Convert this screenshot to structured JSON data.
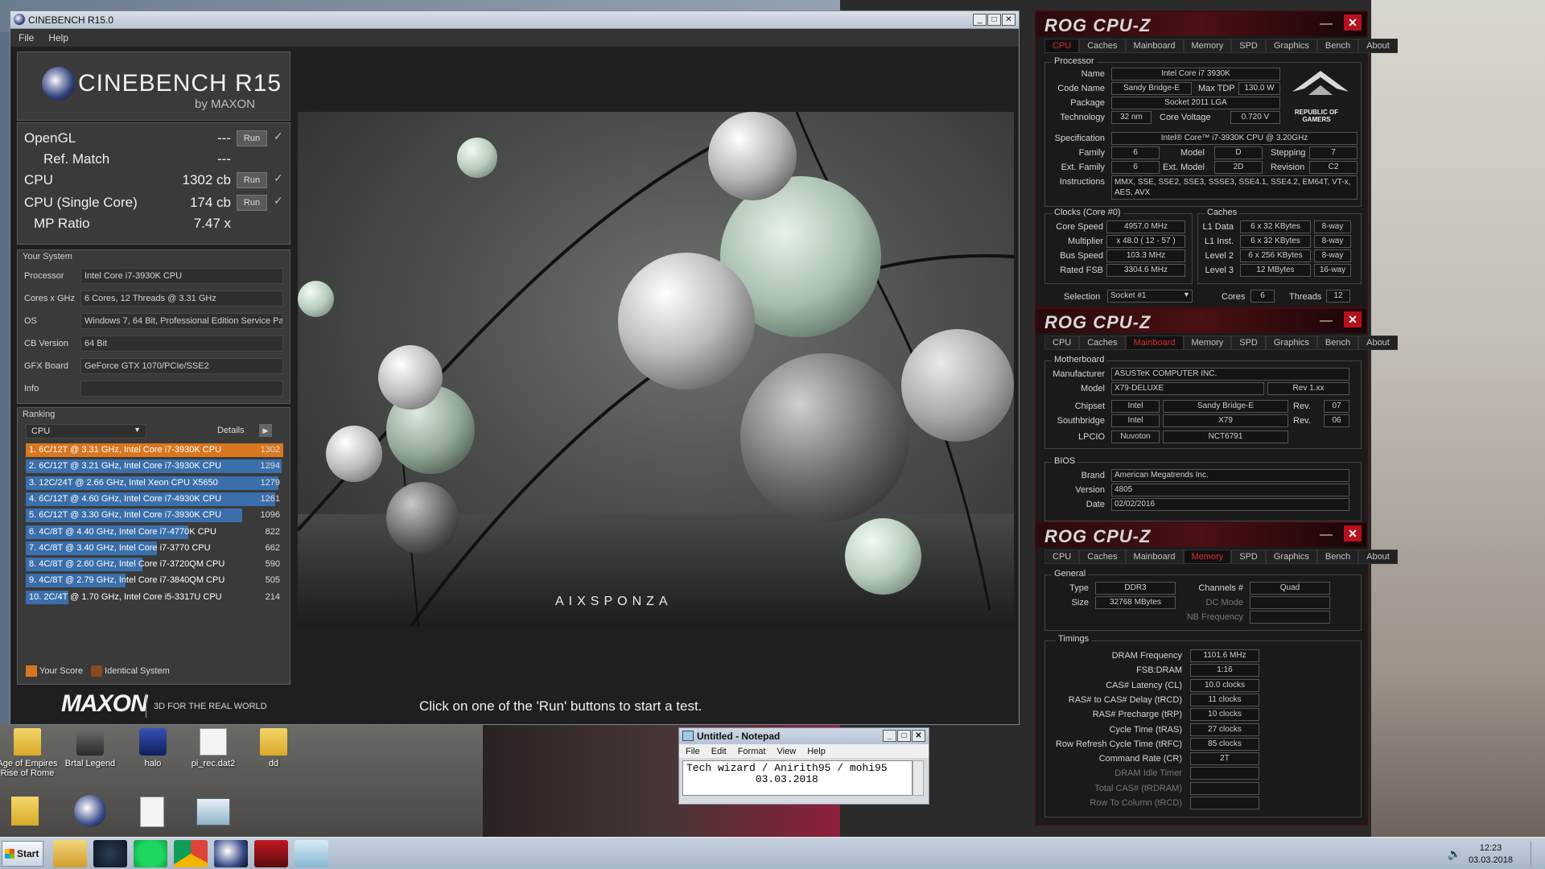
{
  "cinebench": {
    "window_title": "CINEBENCH R15.0",
    "menu": [
      "File",
      "Help"
    ],
    "logo_name": "CINEBENCH R15",
    "logo_by": "by MAXON",
    "scores": {
      "opengl_label": "OpenGL",
      "opengl_value": "---",
      "refmatch_label": "Ref. Match",
      "refmatch_value": "---",
      "cpu_label": "CPU",
      "cpu_value": "1302 cb",
      "single_label": "CPU (Single Core)",
      "single_value": "174 cb",
      "mp_label": "MP Ratio",
      "mp_value": "7.47 x",
      "run_label": "Run"
    },
    "system": {
      "title": "Your System",
      "rows": [
        {
          "k": "Processor",
          "v": "Intel Core i7-3930K CPU"
        },
        {
          "k": "Cores x GHz",
          "v": "6 Cores, 12 Threads @ 3.31 GHz"
        },
        {
          "k": "OS",
          "v": "Windows 7, 64 Bit, Professional Edition Service Pa"
        },
        {
          "k": "CB Version",
          "v": "64 Bit"
        },
        {
          "k": "GFX Board",
          "v": "GeForce GTX 1070/PCIe/SSE2"
        },
        {
          "k": "Info",
          "v": ""
        }
      ]
    },
    "ranking": {
      "title": "Ranking",
      "dropdown": "CPU",
      "details": "Details",
      "max": 1302,
      "rows": [
        {
          "label": "1. 6C/12T @ 3.31 GHz,  Intel Core i7-3930K CPU",
          "score": 1302,
          "color": "#d8771f"
        },
        {
          "label": "2. 6C/12T @ 3.21 GHz,  Intel Core i7-3930K CPU",
          "score": 1294,
          "color": "#3a6fab"
        },
        {
          "label": "3. 12C/24T @ 2.66 GHz, Intel Xeon CPU X5650",
          "score": 1279,
          "color": "#3a6fab"
        },
        {
          "label": "4. 6C/12T @ 4.60 GHz,  Intel Core i7-4930K CPU",
          "score": 1261,
          "color": "#3a6fab"
        },
        {
          "label": "5. 6C/12T @ 3.30 GHz,  Intel Core i7-3930K CPU",
          "score": 1096,
          "color": "#3a6fab"
        },
        {
          "label": "6. 4C/8T @ 4.40 GHz, Intel Core i7-4770K CPU",
          "score": 822,
          "color": "#3a6fab"
        },
        {
          "label": "7. 4C/8T @ 3.40 GHz,  Intel Core i7-3770 CPU",
          "score": 662,
          "color": "#3a6fab"
        },
        {
          "label": "8. 4C/8T @ 2.60 GHz, Intel Core i7-3720QM CPU",
          "score": 590,
          "color": "#3a6fab"
        },
        {
          "label": "9. 4C/8T @ 2.79 GHz,  Intel Core i7-3840QM CPU",
          "score": 505,
          "color": "#3a6fab"
        },
        {
          "label": "10. 2C/4T @ 1.70 GHz,  Intel Core i5-3317U CPU",
          "score": 214,
          "color": "#3a6fab"
        }
      ]
    },
    "legend": {
      "your_score": "Your Score",
      "identical": "Identical System",
      "your_color": "#d8771f",
      "identical_color": "#8a4a1c"
    },
    "footer": {
      "brand": "MAXON",
      "tagline": "3D FOR THE REAL WORLD",
      "status": "Click on one of the 'Run' buttons to start a test."
    },
    "render_credit": "AIXSPONZA"
  },
  "cpuz_cpu": {
    "logo": "ROG CPU-Z",
    "tabs": [
      "CPU",
      "Caches",
      "Mainboard",
      "Memory",
      "SPD",
      "Graphics",
      "Bench",
      "About"
    ],
    "processor_title": "Processor",
    "name_label": "Name",
    "name": "Intel Core i7 3930K",
    "codename_label": "Code Name",
    "codename": "Sandy Bridge-E",
    "maxtdp_label": "Max TDP",
    "maxtdp": "130.0 W",
    "package_label": "Package",
    "package": "Socket 2011 LGA",
    "technology_label": "Technology",
    "technology": "32 nm",
    "corevoltage_label": "Core Voltage",
    "corevoltage": "0.720 V",
    "spec_label": "Specification",
    "spec": "Intel® Core™ i7-3930K CPU @ 3.20GHz",
    "family_label": "Family",
    "family": "6",
    "model_label": "Model",
    "model": "D",
    "stepping_label": "Stepping",
    "stepping": "7",
    "extfamily_label": "Ext. Family",
    "extfamily": "6",
    "extmodel_label": "Ext. Model",
    "extmodel": "2D",
    "revision_label": "Revision",
    "revision": "C2",
    "instructions_label": "Instructions",
    "instructions": "MMX, SSE, SSE2, SSE3, SSSE3, SSE4.1, SSE4.2, EM64T, VT-x, AES, AVX",
    "clocks_title": "Clocks (Core #0)",
    "corespeed_label": "Core Speed",
    "corespeed": "4957.0 MHz",
    "multiplier_label": "Multiplier",
    "multiplier": "x 48.0 ( 12 - 57 )",
    "busspeed_label": "Bus Speed",
    "busspeed": "103.3 MHz",
    "ratedfsb_label": "Rated FSB",
    "ratedfsb": "3304.6 MHz",
    "caches_title": "Caches",
    "l1d_label": "L1 Data",
    "l1d": "6 x 32 KBytes",
    "l1d_way": "8-way",
    "l1i_label": "L1 Inst.",
    "l1i": "6 x 32 KBytes",
    "l1i_way": "8-way",
    "l2_label": "Level 2",
    "l2": "6 x 256 KBytes",
    "l2_way": "8-way",
    "l3_label": "Level 3",
    "l3": "12 MBytes",
    "l3_way": "16-way",
    "selection_label": "Selection",
    "selection": "Socket #1",
    "cores_label": "Cores",
    "cores": "6",
    "threads_label": "Threads",
    "threads": "12",
    "rog_text": "REPUBLIC OF GAMERS"
  },
  "cpuz_mb": {
    "logo": "ROG CPU-Z",
    "tabs": [
      "CPU",
      "Caches",
      "Mainboard",
      "Memory",
      "SPD",
      "Graphics",
      "Bench",
      "About"
    ],
    "mb_title": "Motherboard",
    "manufacturer_label": "Manufacturer",
    "manufacturer": "ASUSTeK COMPUTER INC.",
    "model_label": "Model",
    "model": "X79-DELUXE",
    "rev": "Rev 1.xx",
    "chipset_label": "Chipset",
    "chipset_vendor": "Intel",
    "chipset": "Sandy Bridge-E",
    "chipset_rev_label": "Rev.",
    "chipset_rev": "07",
    "south_label": "Southbridge",
    "south_vendor": "Intel",
    "south": "X79",
    "south_rev_label": "Rev.",
    "south_rev": "06",
    "lpcio_label": "LPCIO",
    "lpcio_vendor": "Nuvoton",
    "lpcio": "NCT6791",
    "bios_title": "BIOS",
    "brand_label": "Brand",
    "brand": "American Megatrends Inc.",
    "version_label": "Version",
    "version": "4805",
    "date_label": "Date",
    "date": "02/02/2016"
  },
  "cpuz_mem": {
    "logo": "ROG CPU-Z",
    "tabs": [
      "CPU",
      "Caches",
      "Mainboard",
      "Memory",
      "SPD",
      "Graphics",
      "Bench",
      "About"
    ],
    "general_title": "General",
    "type_label": "Type",
    "type": "DDR3",
    "size_label": "Size",
    "size": "32768 MBytes",
    "channels_label": "Channels #",
    "channels": "Quad",
    "dcmode_label": "DC Mode",
    "nbfreq_label": "NB Frequency",
    "timings_title": "Timings",
    "timings": [
      {
        "k": "DRAM Frequency",
        "v": "1101.6 MHz",
        "dim": false
      },
      {
        "k": "FSB:DRAM",
        "v": "1:16",
        "dim": false
      },
      {
        "k": "CAS# Latency (CL)",
        "v": "10.0 clocks",
        "dim": false
      },
      {
        "k": "RAS# to CAS# Delay (tRCD)",
        "v": "11 clocks",
        "dim": false
      },
      {
        "k": "RAS# Precharge (tRP)",
        "v": "10 clocks",
        "dim": false
      },
      {
        "k": "Cycle Time (tRAS)",
        "v": "27 clocks",
        "dim": false
      },
      {
        "k": "Row Refresh Cycle Time (tRFC)",
        "v": "85 clocks",
        "dim": false
      },
      {
        "k": "Command Rate (CR)",
        "v": "2T",
        "dim": false
      },
      {
        "k": "DRAM Idle Timer",
        "v": "",
        "dim": true
      },
      {
        "k": "Total CAS# (tRDRAM)",
        "v": "",
        "dim": true
      },
      {
        "k": "Row To Column (tRCD)",
        "v": "",
        "dim": true
      }
    ]
  },
  "notepad": {
    "title": "Untitled - Notepad",
    "menu": [
      "File",
      "Edit",
      "Format",
      "View",
      "Help"
    ],
    "line1": "Tech wizard / Anirith95 / mohi95",
    "line2": "           03.03.2018"
  },
  "desktop_icons": [
    {
      "label": "Age of Empires\nRise of Rome",
      "icon": "folder-icon"
    },
    {
      "label": "Brtal Legend",
      "icon": "game-icon"
    },
    {
      "label": "halo",
      "icon": "game-icon"
    },
    {
      "label": "pi_rec.dat2",
      "icon": "file-icon"
    },
    {
      "label": "dd",
      "icon": "folder-icon"
    }
  ],
  "taskbar": {
    "start": "Start",
    "time": "12:23",
    "date": "03.03.2018"
  }
}
